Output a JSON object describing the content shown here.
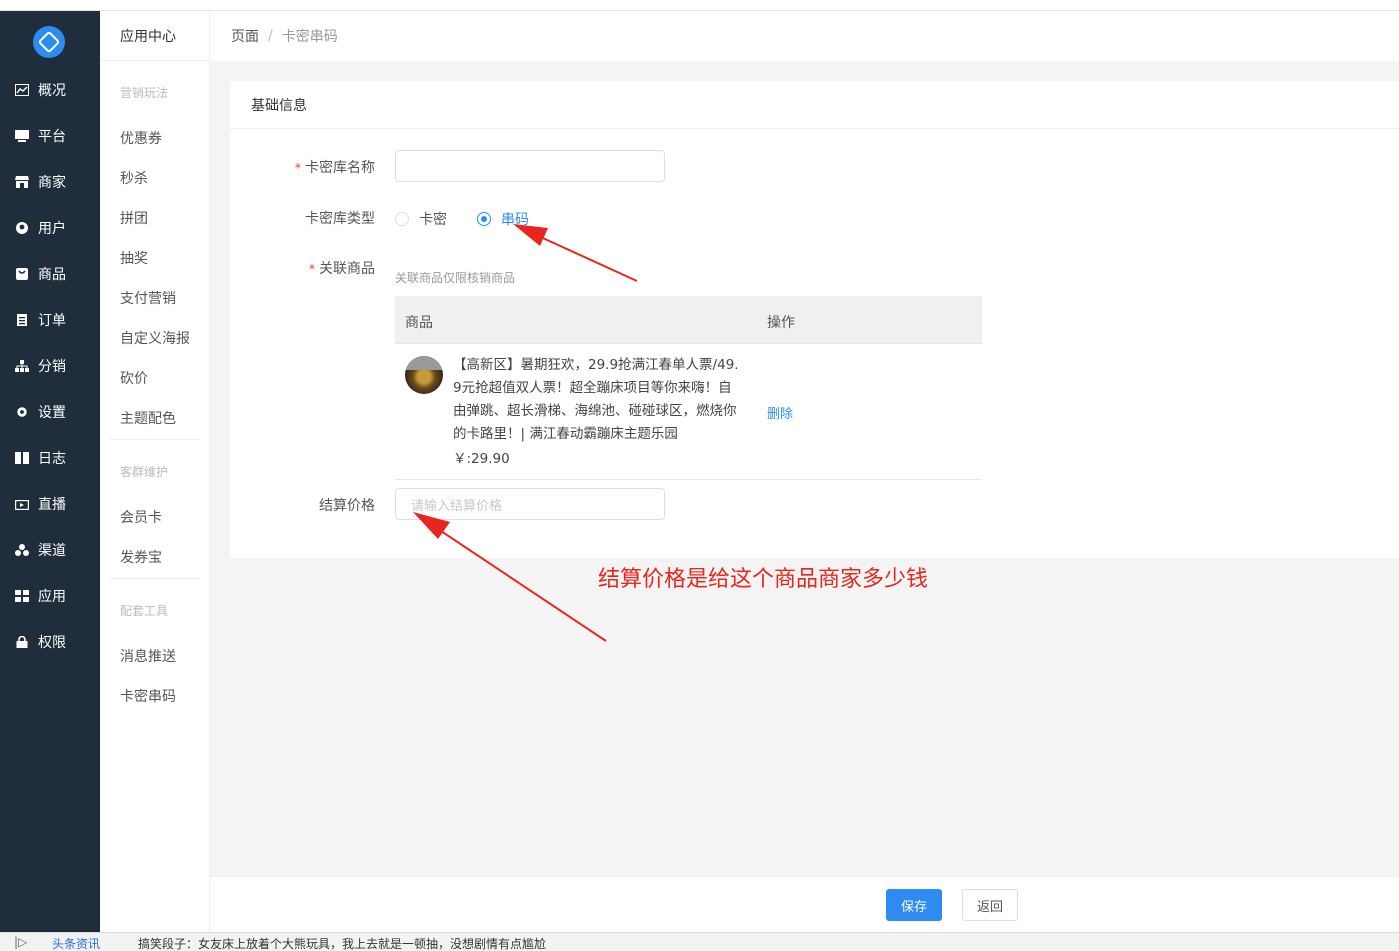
{
  "nav": {
    "items": [
      {
        "label": "概况",
        "icon": "chart-icon"
      },
      {
        "label": "平台",
        "icon": "monitor-icon"
      },
      {
        "label": "商家",
        "icon": "store-icon"
      },
      {
        "label": "用户",
        "icon": "user-icon"
      },
      {
        "label": "商品",
        "icon": "bag-icon"
      },
      {
        "label": "订单",
        "icon": "clipboard-icon"
      },
      {
        "label": "分销",
        "icon": "sitemap-icon"
      },
      {
        "label": "设置",
        "icon": "gear-icon"
      },
      {
        "label": "日志",
        "icon": "book-icon"
      },
      {
        "label": "直播",
        "icon": "tv-icon"
      },
      {
        "label": "渠道",
        "icon": "cluster-icon"
      },
      {
        "label": "应用",
        "icon": "grid-icon"
      },
      {
        "label": "权限",
        "icon": "lock-icon"
      }
    ]
  },
  "submenu": {
    "title": "应用中心",
    "group1": "营销玩法",
    "items1": [
      "优惠券",
      "秒杀",
      "拼团",
      "抽奖",
      "支付营销",
      "自定义海报",
      "砍价",
      "主题配色"
    ],
    "group2": "客群维护",
    "items2": [
      "会员卡",
      "发券宝"
    ],
    "group3": "配套工具",
    "items3": [
      "消息推送",
      "卡密串码"
    ]
  },
  "breadcrumb": {
    "root": "页面",
    "sep": "/",
    "current": "卡密串码"
  },
  "form": {
    "section_title": "基础信息",
    "name_label": "卡密库名称",
    "name_value": "",
    "type_label": "卡密库类型",
    "type_options": [
      "卡密",
      "串码"
    ],
    "type_selected": "串码",
    "goods_label": "关联商品",
    "goods_hint": "关联商品仅限核销商品",
    "table_headers": [
      "商品",
      "操作"
    ],
    "goods": {
      "name_lines": [
        "【高新区】暑期狂欢，29.9抢满江春单人票/49.",
        "9元抢超值双人票！超全蹦床项目等你来嗨！自",
        "由弹跳、超长滑梯、海绵池、碰碰球区，燃烧你",
        "的卡路里！| 满江春动霸蹦床主题乐园"
      ],
      "price": "￥:29.90",
      "action": "删除"
    },
    "settle_label": "结算价格",
    "settle_placeholder": "请输入结算价格",
    "required_mark": "*"
  },
  "annotation": "结算价格是给这个商品商家多少钱",
  "footer": {
    "save": "保存",
    "back": "返回"
  },
  "taskbar": {
    "toggle": "|▷",
    "news": "头条资讯",
    "ticker": "搞笑段子：女友床上放着个大熊玩具，我上去就是一顿抽，没想剧情有点尴尬"
  },
  "colors": {
    "accent": "#2d8cf0",
    "nav_bg": "#1f2d3d",
    "annotation": "#e8261f",
    "required": "#ed4014"
  }
}
